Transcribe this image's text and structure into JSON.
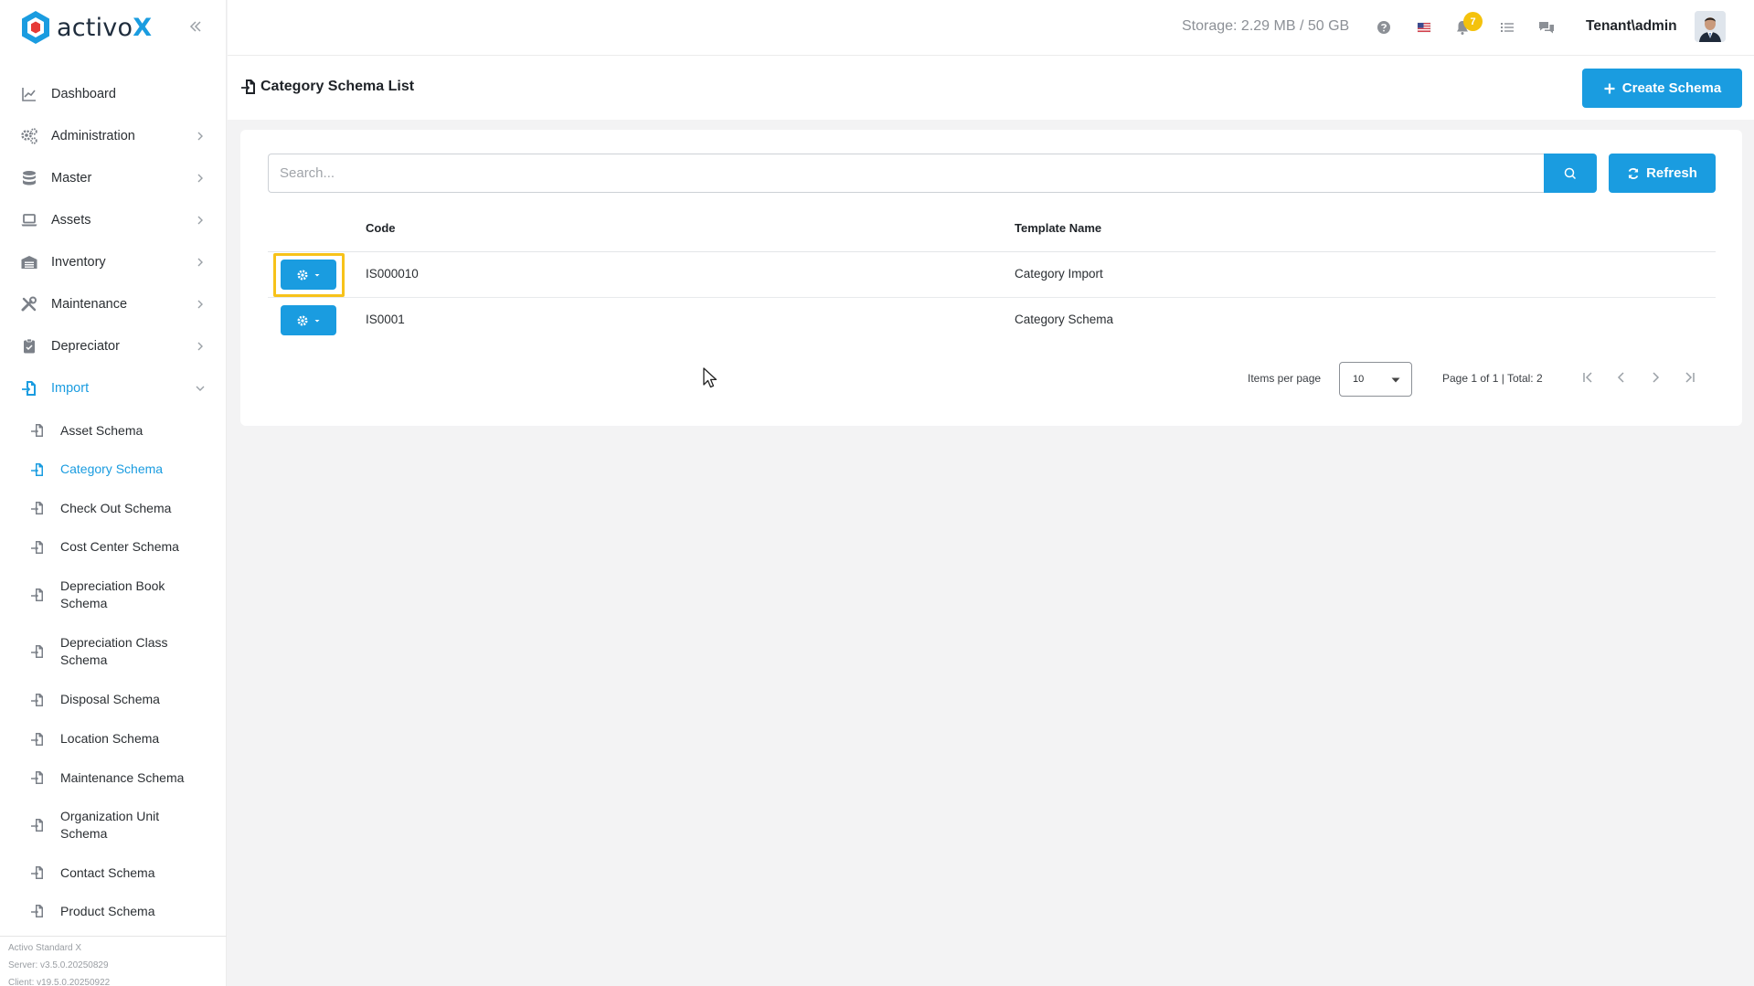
{
  "brand": {
    "name_prefix": "activo",
    "name_suffix": "X"
  },
  "sidebar": {
    "items": [
      {
        "label": "Dashboard",
        "icon": "chart-line-icon",
        "has_chevron": false
      },
      {
        "label": "Administration",
        "icon": "cogs-icon",
        "has_chevron": true
      },
      {
        "label": "Master",
        "icon": "database-icon",
        "has_chevron": true
      },
      {
        "label": "Assets",
        "icon": "laptop-icon",
        "has_chevron": true
      },
      {
        "label": "Inventory",
        "icon": "warehouse-icon",
        "has_chevron": true
      },
      {
        "label": "Maintenance",
        "icon": "tools-icon",
        "has_chevron": true
      },
      {
        "label": "Depreciator",
        "icon": "clipboard-icon",
        "has_chevron": true
      },
      {
        "label": "Import",
        "icon": "file-import-icon",
        "has_chevron": true,
        "active": true
      }
    ],
    "import_sub_items": [
      {
        "label": "Asset Schema"
      },
      {
        "label": "Category Schema",
        "active": true
      },
      {
        "label": "Check Out Schema"
      },
      {
        "label": "Cost Center Schema"
      },
      {
        "label": "Depreciation Book Schema"
      },
      {
        "label": "Depreciation Class Schema"
      },
      {
        "label": "Disposal Schema"
      },
      {
        "label": "Location Schema"
      },
      {
        "label": "Maintenance Schema"
      },
      {
        "label": "Organization Unit Schema"
      },
      {
        "label": "Contact Schema"
      },
      {
        "label": "Product Schema"
      }
    ],
    "footer": {
      "edition": "Activo Standard X",
      "server": "Server: v3.5.0.20250829",
      "client": "Client: v19.5.0.20250922"
    }
  },
  "topbar": {
    "storage": "Storage: 2.29 MB / 50 GB",
    "notification_count": "7",
    "user": "Tenant\\admin",
    "icons": [
      "help-icon",
      "us-flag-icon",
      "bell-icon",
      "tasks-icon",
      "chat-icon"
    ]
  },
  "page": {
    "title": "Category Schema List",
    "create_button": "Create Schema",
    "search_placeholder": "Search...",
    "refresh_button": "Refresh"
  },
  "table": {
    "columns": [
      "Code",
      "Template Name"
    ],
    "rows": [
      {
        "code": "IS000010",
        "template_name": "Category Import"
      },
      {
        "code": "IS0001",
        "template_name": "Category Schema"
      }
    ]
  },
  "pagination": {
    "items_per_page_label": "Items per page",
    "items_per_page_value": "10",
    "page_info": "Page 1 of 1 | Total: 2"
  },
  "colors": {
    "accent": "#1a9ce0",
    "highlight": "#f7c21a",
    "badge": "#f4c20d"
  }
}
